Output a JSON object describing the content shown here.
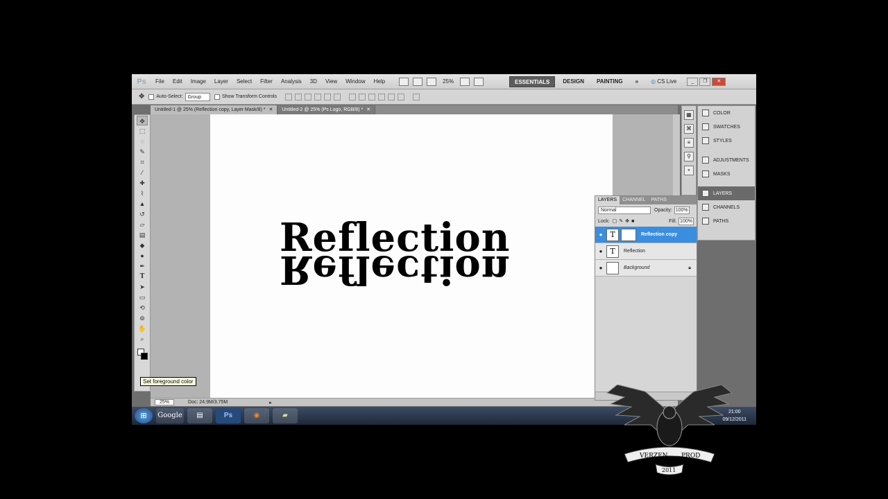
{
  "menubar": {
    "logo": "Ps",
    "items": [
      "File",
      "Edit",
      "Image",
      "Layer",
      "Select",
      "Filter",
      "Analysis",
      "3D",
      "View",
      "Window",
      "Help"
    ],
    "zoom": "25%",
    "workspaces": [
      "ESSENTIALS",
      "DESIGN",
      "PAINTING"
    ],
    "more": "»",
    "cs_live": "CS Live"
  },
  "options": {
    "auto_select_label": "Auto-Select:",
    "auto_select_value": "Group",
    "show_transform": "Show Transform Controls"
  },
  "tabs": [
    {
      "label": "Untitled-1 @ 25% (Reflection copy, Layer Mask/8) *",
      "close": "✕"
    },
    {
      "label": "Untitled-2 @ 25% (Ps Logo, RGB/8) *",
      "close": "✕"
    }
  ],
  "canvas": {
    "text": "Reflection",
    "reflection": "Reflection"
  },
  "tooltip": "Set foreground color",
  "status": {
    "zoom": "25%",
    "doc": "Doc: 24.9M/3.75M"
  },
  "dock": {
    "items": [
      "COLOR",
      "SWATCHES",
      "STYLES",
      "ADJUSTMENTS",
      "MASKS",
      "LAYERS",
      "CHANNELS",
      "PATHS"
    ]
  },
  "layers_panel": {
    "tabs": [
      "LAYERS",
      "CHANNEL",
      "PATHS"
    ],
    "blend_mode": "Normal",
    "opacity_label": "Opacity:",
    "opacity": "100%",
    "lock_label": "Lock:",
    "fill_label": "Fill:",
    "fill": "100%",
    "layers": [
      {
        "name": "Reflection copy",
        "thumb": "T"
      },
      {
        "name": "Reflection",
        "thumb": "T"
      },
      {
        "name": "Background",
        "thumb": ""
      }
    ]
  },
  "taskbar": {
    "google": "Google",
    "time": "21:00",
    "date": "09/12/2011"
  },
  "watermark": {
    "text_left": "VERZEN",
    "text_right": "PROD",
    "year": "2011"
  }
}
